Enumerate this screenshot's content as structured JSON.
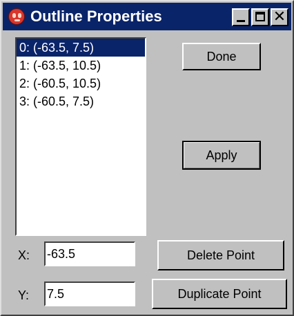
{
  "window": {
    "title": "Outline Properties",
    "icon": "app-face-icon",
    "controls": {
      "minimize": "minimize-icon",
      "maximize": "maximize-icon",
      "close_glyph": "✕"
    }
  },
  "points_list": {
    "items": [
      {
        "label": "0: (-63.5, 7.5)",
        "selected": true
      },
      {
        "label": "1: (-63.5, 10.5)",
        "selected": false
      },
      {
        "label": "2: (-60.5, 10.5)",
        "selected": false
      },
      {
        "label": "3: (-60.5, 7.5)",
        "selected": false
      }
    ]
  },
  "buttons": {
    "done": "Done",
    "apply": "Apply",
    "delete_point": "Delete Point",
    "duplicate_point": "Duplicate Point"
  },
  "fields": {
    "x_label": "X:",
    "x_value": "-63.5",
    "y_label": "Y:",
    "y_value": "7.5"
  },
  "colors": {
    "title_bar": "#0a246a",
    "face": "#c0c0c0",
    "selection": "#0a246a"
  }
}
